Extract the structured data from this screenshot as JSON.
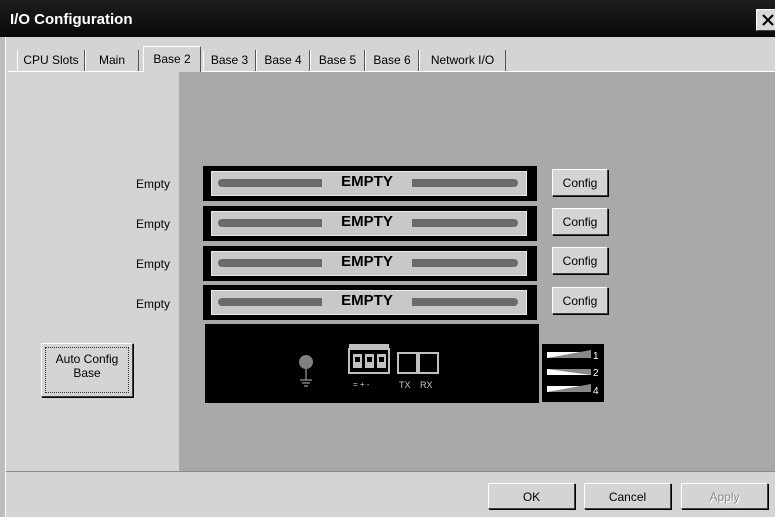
{
  "window": {
    "title": "I/O Configuration",
    "close_icon": "close-icon"
  },
  "tabs": [
    {
      "label": "CPU Slots"
    },
    {
      "label": "Main"
    },
    {
      "label": "Base 2",
      "selected": true
    },
    {
      "label": "Base 3"
    },
    {
      "label": "Base 4"
    },
    {
      "label": "Base 5"
    },
    {
      "label": "Base 6"
    },
    {
      "label": "Network I/O"
    }
  ],
  "slots": [
    {
      "label": "Empty",
      "module": "EMPTY",
      "button": "Config"
    },
    {
      "label": "Empty",
      "module": "EMPTY",
      "button": "Config"
    },
    {
      "label": "Empty",
      "module": "EMPTY",
      "button": "Config"
    },
    {
      "label": "Empty",
      "module": "EMPTY",
      "button": "Config"
    }
  ],
  "base_module": {
    "ports": [
      "TX",
      "RX"
    ],
    "terminal_marks": "= + -",
    "dip_switches": [
      "1",
      "2",
      "4"
    ]
  },
  "auto_config": {
    "label": "Auto Config\nBase"
  },
  "footer": {
    "ok": "OK",
    "cancel": "Cancel",
    "apply": "Apply"
  },
  "colors": {
    "panel": "#a9a9a9",
    "dialog": "#d4d4d4",
    "titlebar": "#111111"
  }
}
